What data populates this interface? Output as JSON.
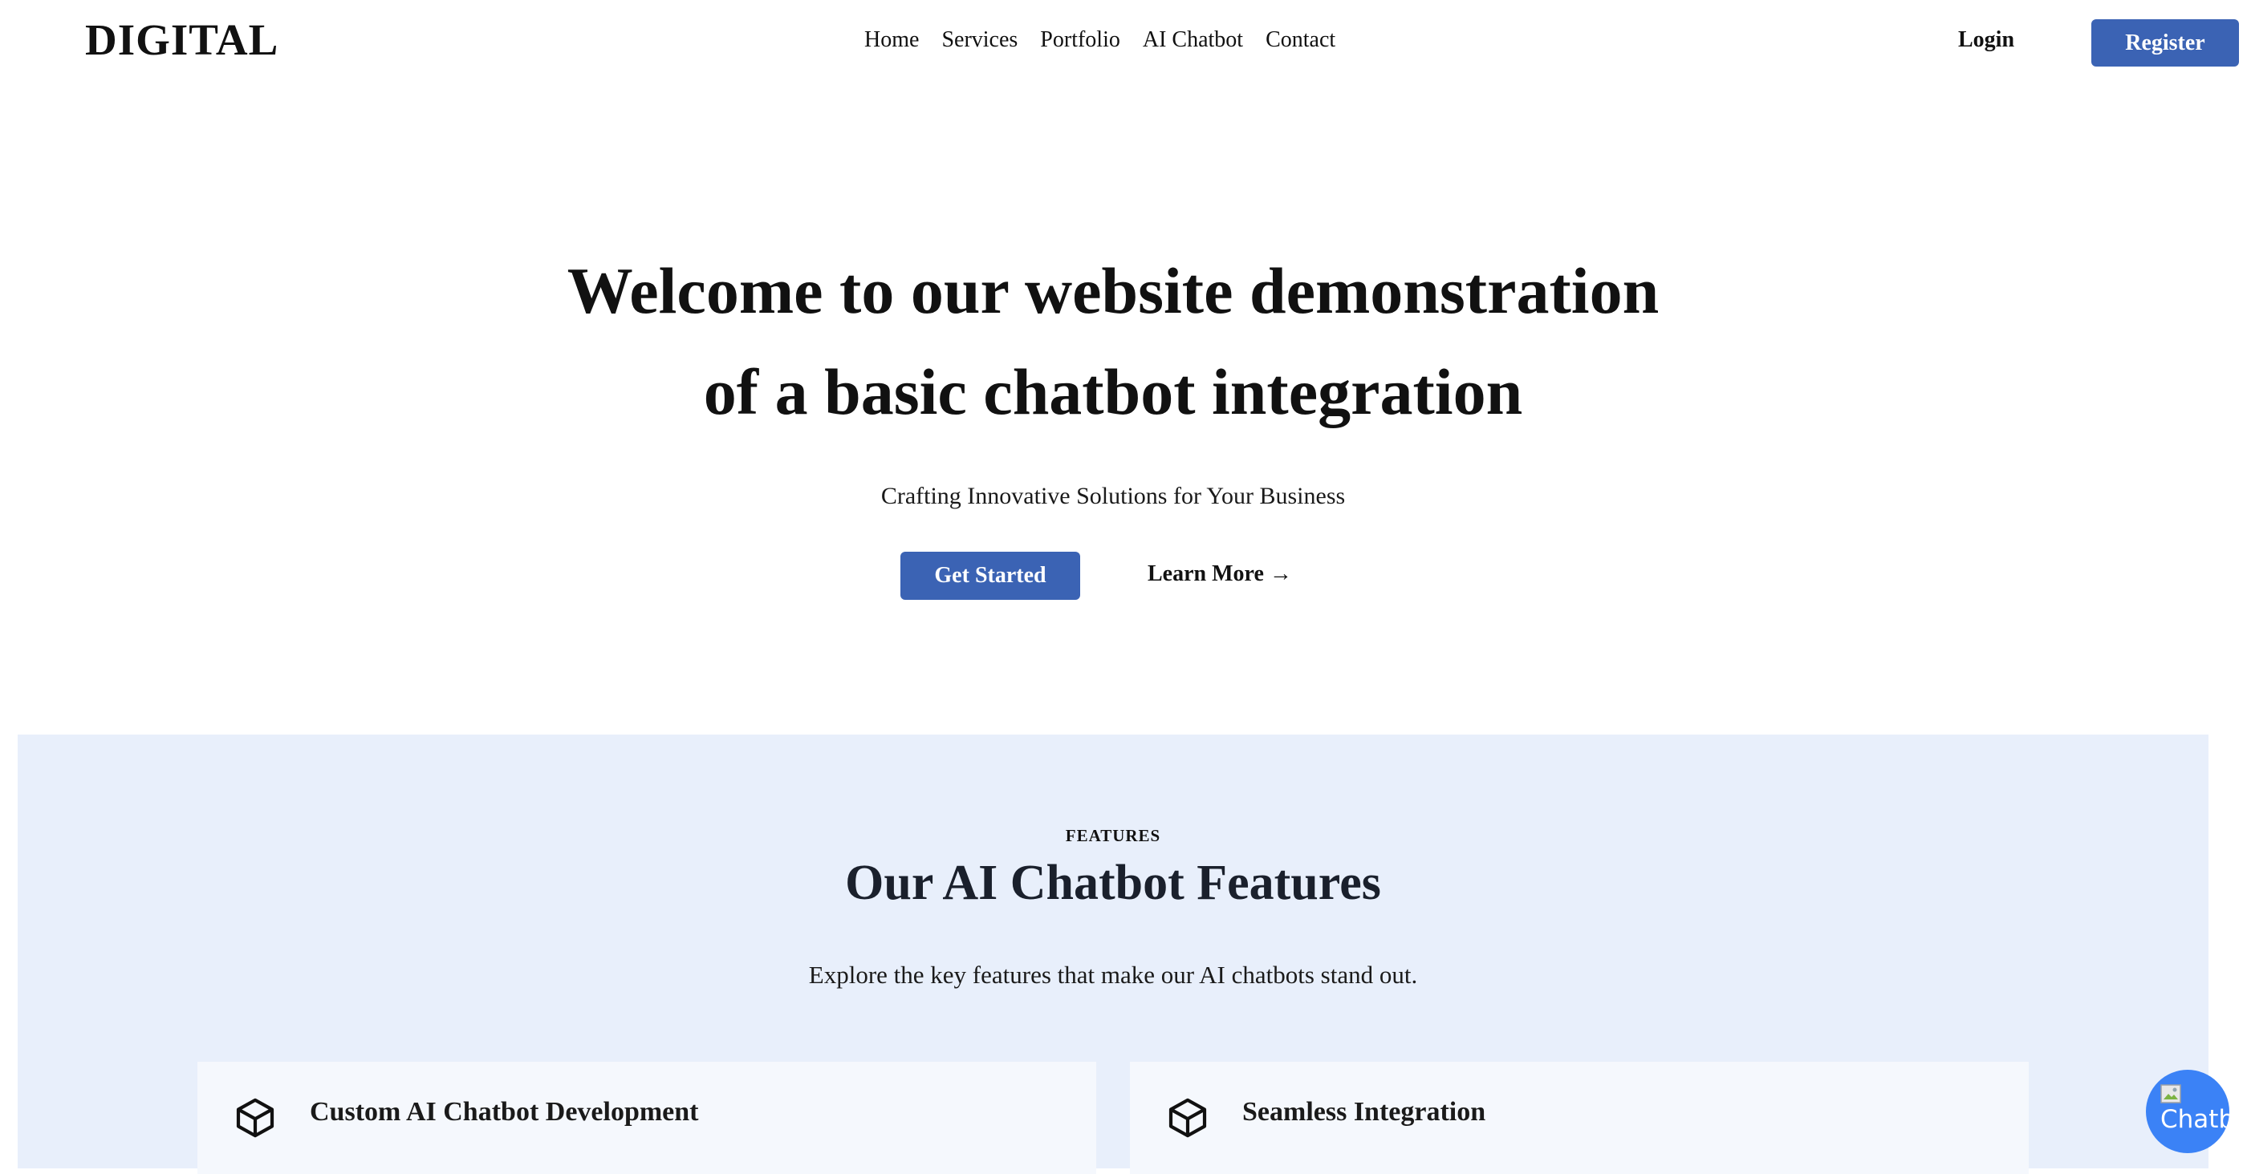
{
  "header": {
    "logo": "DIGITAL",
    "nav": [
      "Home",
      "Services",
      "Portfolio",
      "AI Chatbot",
      "Contact"
    ],
    "login_label": "Login",
    "register_label": "Register"
  },
  "hero": {
    "title_line1": "Welcome to our website demonstration",
    "title_line2": "of a basic chatbot integration",
    "subtitle": "Crafting Innovative Solutions for Your Business",
    "primary_button": "Get Started",
    "secondary_link": "Learn More →"
  },
  "features": {
    "eyebrow": "FEATURES",
    "title": "Our AI Chatbot Features",
    "description": "Explore the key features that make our AI chatbots stand out.",
    "cards": [
      {
        "icon": "cube-icon",
        "title": "Custom AI Chatbot Development",
        "description": ""
      },
      {
        "icon": "cube-icon",
        "title": "Seamless Integration",
        "description": ""
      }
    ]
  },
  "chat_widget": {
    "alt_text": "Chatbot",
    "icon": "broken-image-icon"
  },
  "colors": {
    "accent": "#3b63b4",
    "features_bg": "#e8effb",
    "card_bg": "#f5f8fd",
    "chat_bubble": "#3b82f6"
  }
}
